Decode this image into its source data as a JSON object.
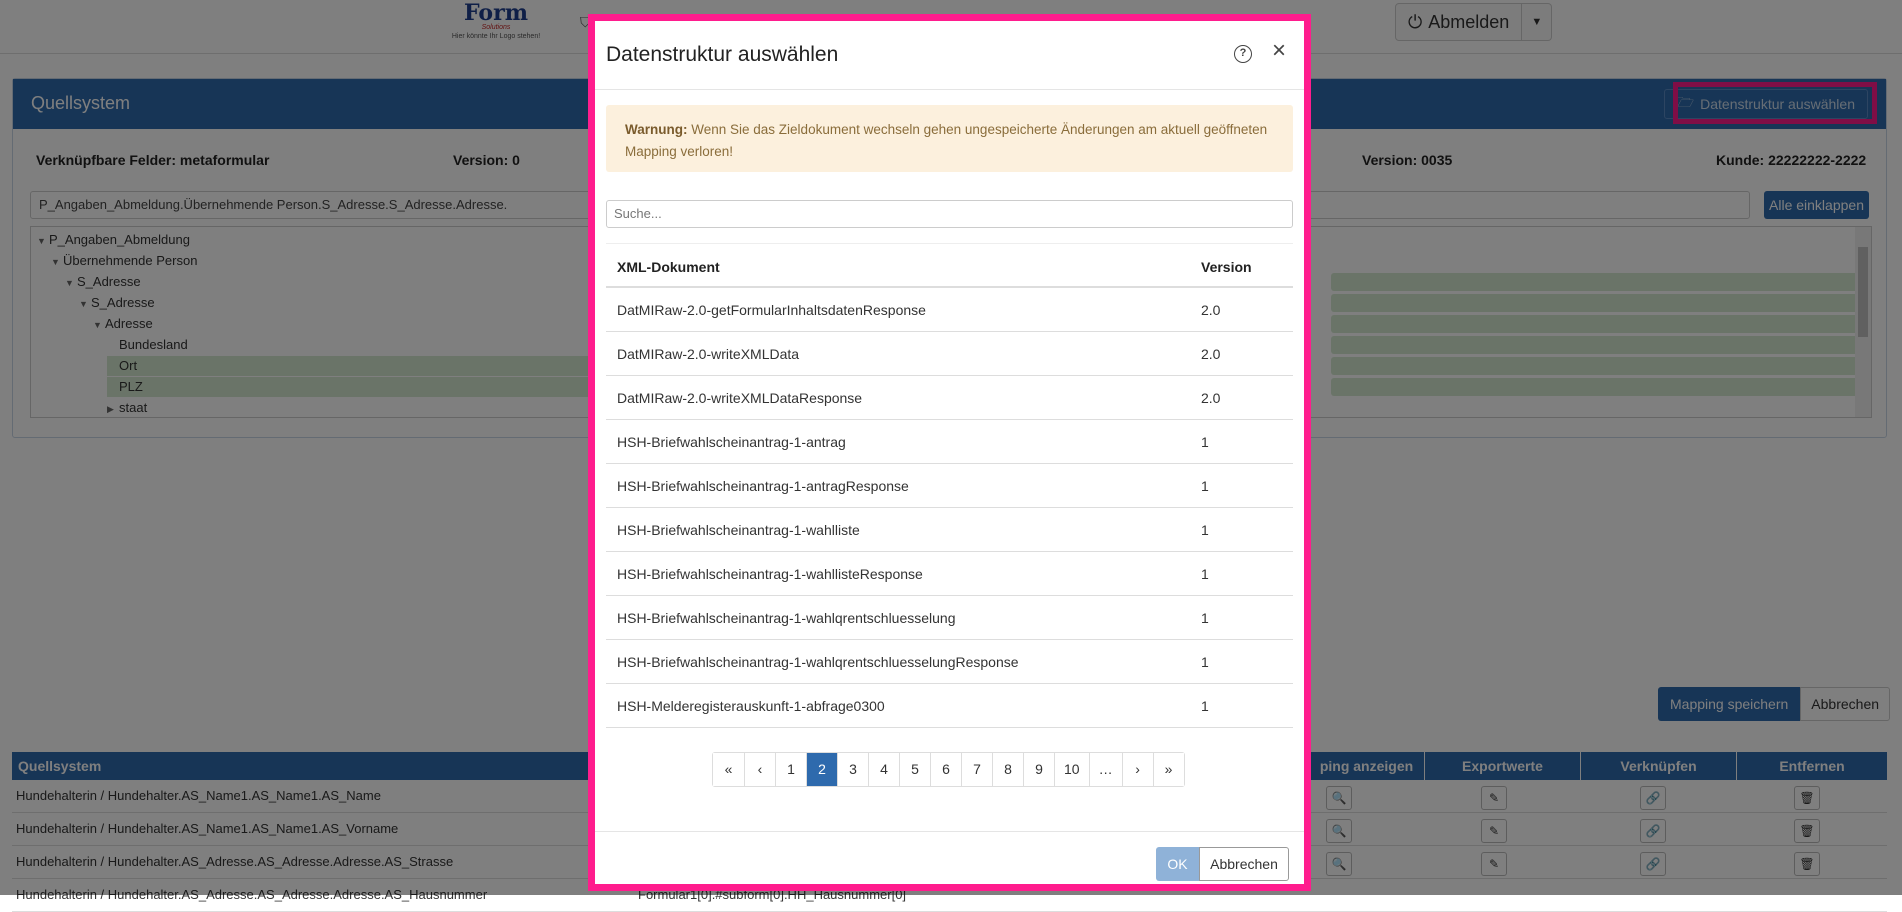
{
  "topbar": {
    "logo_brand": "Form",
    "logo_sub": "Solutions",
    "logo_tag": "Hier könnte Ihr Logo stehen!",
    "logout_label": "Abmelden"
  },
  "panel": {
    "title": "Quellsystem",
    "select_structure_label": "Datenstruktur auswählen",
    "linkable_fields": "Verknüpfbare Felder: metaformular",
    "version_left": "Version: 0",
    "version_right": "Version: 0035",
    "customer": "Kunde: 22222222-2222",
    "path_value": "P_Angaben_Abmeldung.Übernehmende Person.S_Adresse.S_Adresse.Adresse.",
    "collapse_all_label": "Alle einklappen",
    "tree": [
      "P_Angaben_Abmeldung",
      "Übernehmende Person",
      "S_Adresse",
      "S_Adresse",
      "Adresse",
      "Bundesland",
      "Ort",
      "PLZ",
      "staat"
    ]
  },
  "actions": {
    "save_mapping": "Mapping speichern",
    "cancel": "Abbrechen"
  },
  "grid": {
    "headers": [
      "Quellsystem",
      "ping anzeigen",
      "Exportwerte",
      "Verknüpfen",
      "Entfernen"
    ],
    "rows": [
      "Hundehalterin / Hundehalter.AS_Name1.AS_Name1.AS_Name",
      "Hundehalterin / Hundehalter.AS_Name1.AS_Name1.AS_Vorname",
      "Hundehalterin / Hundehalter.AS_Adresse.AS_Adresse.Adresse.AS_Strasse",
      "Hundehalterin / Hundehalter.AS_Adresse.AS_Adresse.Adresse.AS_Hausnummer"
    ],
    "row4_target": "Formular1[0].#subform[0].HH_Hausnummer[0]"
  },
  "modal": {
    "title": "Datenstruktur auswählen",
    "warning_label": "Warnung:",
    "warning_text": "Wenn Sie das Zieldokument wechseln gehen ungespeicherte Änderungen am aktuell geöffneten Mapping verloren!",
    "search_placeholder": "Suche...",
    "columns": [
      "XML-Dokument",
      "Version"
    ],
    "rows": [
      {
        "doc": "DatMIRaw-2.0-getFormularInhaltsdatenResponse",
        "version": "2.0"
      },
      {
        "doc": "DatMIRaw-2.0-writeXMLData",
        "version": "2.0"
      },
      {
        "doc": "DatMIRaw-2.0-writeXMLDataResponse",
        "version": "2.0"
      },
      {
        "doc": "HSH-Briefwahlscheinantrag-1-antrag",
        "version": "1"
      },
      {
        "doc": "HSH-Briefwahlscheinantrag-1-antragResponse",
        "version": "1"
      },
      {
        "doc": "HSH-Briefwahlscheinantrag-1-wahlliste",
        "version": "1"
      },
      {
        "doc": "HSH-Briefwahlscheinantrag-1-wahllisteResponse",
        "version": "1"
      },
      {
        "doc": "HSH-Briefwahlscheinantrag-1-wahlqrentschluesselung",
        "version": "1"
      },
      {
        "doc": "HSH-Briefwahlscheinantrag-1-wahlqrentschluesselungResponse",
        "version": "1"
      },
      {
        "doc": "HSH-Melderegisterauskunft-1-abfrage0300",
        "version": "1"
      }
    ],
    "pagination": [
      "«",
      "‹",
      "1",
      "2",
      "3",
      "4",
      "5",
      "6",
      "7",
      "8",
      "9",
      "10",
      "…",
      "›",
      "»"
    ],
    "active_page": "2",
    "ok_label": "OK",
    "cancel_label": "Abbrechen"
  },
  "colors": {
    "primary": "#2e6aad",
    "highlight": "#ff1c8d",
    "warning_bg": "#fcf0dd",
    "tree_highlight": "#d5e8d0"
  }
}
